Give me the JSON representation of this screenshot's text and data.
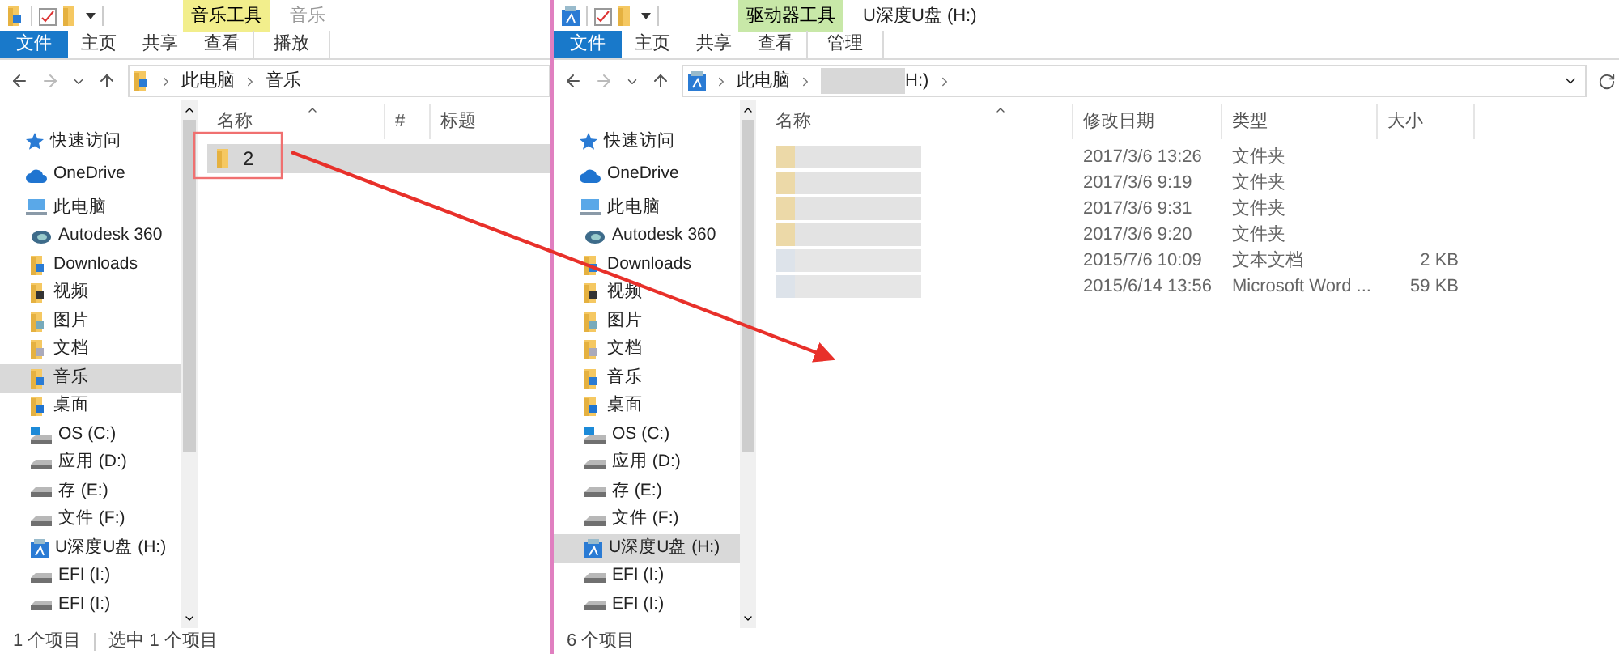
{
  "windows": [
    {
      "title": "音乐",
      "context_tab": {
        "label": "音乐工具",
        "color": "#f2ee8c"
      },
      "tabs": [
        {
          "label": "文件",
          "kind": "file",
          "selected": false
        },
        {
          "label": "主页",
          "kind": "plain",
          "selected": false
        },
        {
          "label": "共享",
          "kind": "plain",
          "selected": false
        },
        {
          "label": "查看",
          "kind": "plain",
          "selected": false
        },
        {
          "label": "播放",
          "kind": "context",
          "selected": false
        }
      ],
      "address": [
        {
          "kind": "text",
          "text": "此电脑"
        },
        {
          "kind": "text",
          "text": "音乐"
        }
      ],
      "sidebar": [
        {
          "label": "快速访问",
          "kind": "star",
          "selected": false
        },
        {
          "label": "OneDrive",
          "kind": "cloud",
          "selected": false
        },
        {
          "label": "此电脑",
          "kind": "pc",
          "selected": false,
          "children": [
            {
              "label": "Autodesk 360",
              "kind": "autodesk",
              "selected": false
            },
            {
              "label": "Downloads",
              "kind": "downloads",
              "selected": false
            },
            {
              "label": "视频",
              "kind": "video",
              "selected": false
            },
            {
              "label": "图片",
              "kind": "pictures",
              "selected": false
            },
            {
              "label": "文档",
              "kind": "docs",
              "selected": false
            },
            {
              "label": "音乐",
              "kind": "music",
              "selected": true
            },
            {
              "label": "桌面",
              "kind": "desktop",
              "selected": false
            },
            {
              "label": "OS (C:)",
              "kind": "windrive",
              "selected": false
            },
            {
              "label": "应用 (D:)",
              "kind": "drive",
              "selected": false
            },
            {
              "label": "存 (E:)",
              "kind": "drive",
              "selected": false
            },
            {
              "label": "文件 (F:)",
              "kind": "drive",
              "selected": false
            },
            {
              "label": "U深度U盘 (H:)",
              "kind": "usb",
              "selected": false
            },
            {
              "label": "EFI (I:)",
              "kind": "drive",
              "selected": false
            },
            {
              "label": "EFI (I:)",
              "kind": "drive",
              "selected": false
            }
          ]
        }
      ],
      "columns": [
        {
          "label": "名称",
          "kind": "name"
        },
        {
          "label": "#",
          "kind": "narrow"
        },
        {
          "label": "标题",
          "kind": "wide"
        }
      ],
      "rows": [
        {
          "name_blurred": false,
          "cells": [
            "2"
          ],
          "kind": "folder",
          "selected": true
        }
      ],
      "status": [
        "1 个项目",
        "选中 1 个项目"
      ]
    },
    {
      "title": "U深度U盘 (H:)",
      "context_tab": {
        "label": "驱动器工具",
        "color": "#c8e8a8"
      },
      "tabs": [
        {
          "label": "文件",
          "kind": "file",
          "selected": false
        },
        {
          "label": "主页",
          "kind": "plain",
          "selected": false
        },
        {
          "label": "共享",
          "kind": "plain",
          "selected": false
        },
        {
          "label": "查看",
          "kind": "plain",
          "selected": false
        },
        {
          "label": "管理",
          "kind": "context",
          "selected": false
        }
      ],
      "address": [
        {
          "kind": "text",
          "text": "此电脑"
        },
        {
          "kind": "blurred",
          "text": "H:)"
        }
      ],
      "sidebar": [
        {
          "label": "快速访问",
          "kind": "star",
          "selected": false
        },
        {
          "label": "OneDrive",
          "kind": "cloud",
          "selected": false
        },
        {
          "label": "此电脑",
          "kind": "pc",
          "selected": false,
          "children": [
            {
              "label": "Autodesk 360",
              "kind": "autodesk",
              "selected": false
            },
            {
              "label": "Downloads",
              "kind": "downloads",
              "selected": false
            },
            {
              "label": "视频",
              "kind": "video",
              "selected": false
            },
            {
              "label": "图片",
              "kind": "pictures",
              "selected": false
            },
            {
              "label": "文档",
              "kind": "docs",
              "selected": false
            },
            {
              "label": "音乐",
              "kind": "music",
              "selected": false
            },
            {
              "label": "桌面",
              "kind": "desktop",
              "selected": false
            },
            {
              "label": "OS (C:)",
              "kind": "windrive",
              "selected": false
            },
            {
              "label": "应用 (D:)",
              "kind": "drive",
              "selected": false
            },
            {
              "label": "存 (E:)",
              "kind": "drive",
              "selected": false
            },
            {
              "label": "文件 (F:)",
              "kind": "drive",
              "selected": false
            },
            {
              "label": "U深度U盘 (H:)",
              "kind": "usb",
              "selected": true
            },
            {
              "label": "EFI (I:)",
              "kind": "drive",
              "selected": false
            },
            {
              "label": "EFI (I:)",
              "kind": "drive",
              "selected": false
            }
          ]
        }
      ],
      "columns": [
        {
          "label": "名称",
          "kind": "name"
        },
        {
          "label": "修改日期",
          "kind": "date"
        },
        {
          "label": "类型",
          "kind": "type"
        },
        {
          "label": "大小",
          "kind": "size"
        }
      ],
      "rows": [
        {
          "name_blurred": true,
          "cells": [
            "",
            "2017/3/6 13:26",
            "文件夹",
            ""
          ],
          "kind": "folder",
          "selected": false
        },
        {
          "name_blurred": true,
          "cells": [
            "",
            "2017/3/6 9:19",
            "文件夹",
            ""
          ],
          "kind": "folder",
          "selected": false
        },
        {
          "name_blurred": true,
          "cells": [
            "",
            "2017/3/6 9:31",
            "文件夹",
            ""
          ],
          "kind": "folder",
          "selected": false
        },
        {
          "name_blurred": true,
          "cells": [
            "",
            "2017/3/6 9:20",
            "文件夹",
            ""
          ],
          "kind": "folder",
          "selected": false
        },
        {
          "name_blurred": true,
          "cells": [
            "",
            "2015/7/6 10:09",
            "文本文档",
            "2 KB"
          ],
          "kind": "file",
          "selected": false
        },
        {
          "name_blurred": true,
          "cells": [
            "",
            "2015/6/14 13:56",
            "Microsoft Word ...",
            "59 KB"
          ],
          "kind": "file",
          "selected": false
        }
      ],
      "status": [
        "6 个项目"
      ]
    }
  ]
}
